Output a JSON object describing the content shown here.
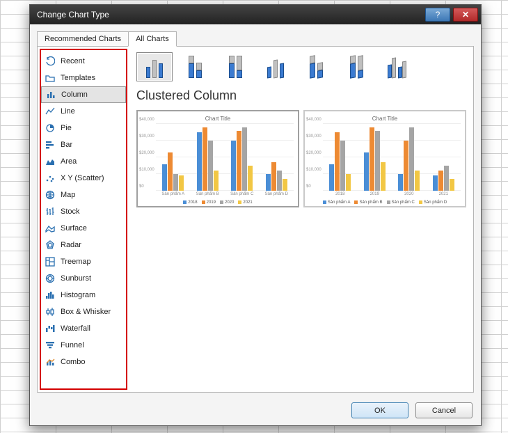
{
  "dialog": {
    "title": "Change Chart Type",
    "help_glyph": "?",
    "close_glyph": "✕"
  },
  "tabs": {
    "recommended": "Recommended Charts",
    "all": "All Charts"
  },
  "sidebar": [
    {
      "id": "recent",
      "label": "Recent",
      "icon": "recent"
    },
    {
      "id": "templates",
      "label": "Templates",
      "icon": "folder"
    },
    {
      "id": "column",
      "label": "Column",
      "icon": "column",
      "selected": true
    },
    {
      "id": "line",
      "label": "Line",
      "icon": "line"
    },
    {
      "id": "pie",
      "label": "Pie",
      "icon": "pie"
    },
    {
      "id": "bar",
      "label": "Bar",
      "icon": "bar"
    },
    {
      "id": "area",
      "label": "Area",
      "icon": "area"
    },
    {
      "id": "scatter",
      "label": "X Y (Scatter)",
      "icon": "scatter"
    },
    {
      "id": "map",
      "label": "Map",
      "icon": "map"
    },
    {
      "id": "stock",
      "label": "Stock",
      "icon": "stock"
    },
    {
      "id": "surface",
      "label": "Surface",
      "icon": "surface"
    },
    {
      "id": "radar",
      "label": "Radar",
      "icon": "radar"
    },
    {
      "id": "treemap",
      "label": "Treemap",
      "icon": "treemap"
    },
    {
      "id": "sunburst",
      "label": "Sunburst",
      "icon": "sunburst"
    },
    {
      "id": "histogram",
      "label": "Histogram",
      "icon": "histogram"
    },
    {
      "id": "boxwhisker",
      "label": "Box & Whisker",
      "icon": "box"
    },
    {
      "id": "waterfall",
      "label": "Waterfall",
      "icon": "waterfall"
    },
    {
      "id": "funnel",
      "label": "Funnel",
      "icon": "funnel"
    },
    {
      "id": "combo",
      "label": "Combo",
      "icon": "combo"
    }
  ],
  "heading": "Clustered Column",
  "preview_title": "Chart Title",
  "buttons": {
    "ok": "OK",
    "cancel": "Cancel"
  },
  "chart_data": [
    {
      "type": "bar",
      "title": "Chart Title",
      "ylabel": "",
      "xlabel": "",
      "ylim": [
        0,
        40000
      ],
      "yticks": [
        "$0",
        "$10,000",
        "$20,000",
        "$30,000",
        "$40,000"
      ],
      "categories": [
        "Sản phẩm A",
        "Sản phẩm B",
        "Sản phẩm C",
        "Sản phẩm D"
      ],
      "series": [
        {
          "name": "2018",
          "color": "#4a8ed6",
          "values": [
            16000,
            35000,
            30000,
            10000
          ]
        },
        {
          "name": "2019",
          "color": "#ed8a33",
          "values": [
            23000,
            38000,
            36000,
            17000
          ]
        },
        {
          "name": "2020",
          "color": "#a5a5a5",
          "values": [
            10000,
            30000,
            38000,
            12000
          ]
        },
        {
          "name": "2021",
          "color": "#f2c744",
          "values": [
            9000,
            12000,
            15000,
            7000
          ]
        }
      ]
    },
    {
      "type": "bar",
      "title": "Chart Title",
      "ylabel": "",
      "xlabel": "",
      "ylim": [
        0,
        40000
      ],
      "yticks": [
        "$0",
        "$10,000",
        "$20,000",
        "$30,000",
        "$40,000"
      ],
      "categories": [
        "2018",
        "2019",
        "2020",
        "2021"
      ],
      "series": [
        {
          "name": "Sản phẩm A",
          "color": "#4a8ed6",
          "values": [
            16000,
            23000,
            10000,
            9000
          ]
        },
        {
          "name": "Sản phẩm B",
          "color": "#ed8a33",
          "values": [
            35000,
            38000,
            30000,
            12000
          ]
        },
        {
          "name": "Sản phẩm C",
          "color": "#a5a5a5",
          "values": [
            30000,
            36000,
            38000,
            15000
          ]
        },
        {
          "name": "Sản phẩm D",
          "color": "#f2c744",
          "values": [
            10000,
            17000,
            12000,
            7000
          ]
        }
      ]
    }
  ]
}
